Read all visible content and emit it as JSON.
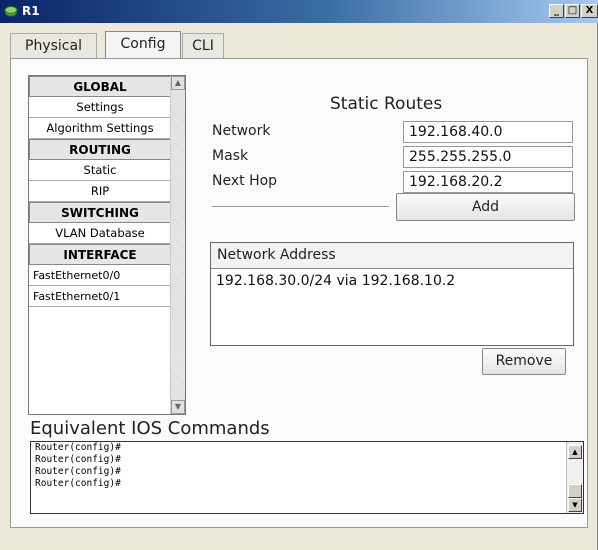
{
  "window": {
    "title": "R1",
    "minimize": "_",
    "maximize": "□",
    "close": "X"
  },
  "tabs": [
    {
      "label": "Physical"
    },
    {
      "label": "Config",
      "selected": true
    },
    {
      "label": "CLI"
    }
  ],
  "sidebar": {
    "items": [
      {
        "label": "GLOBAL",
        "header": true
      },
      {
        "label": "Settings"
      },
      {
        "label": "Algorithm Settings"
      },
      {
        "label": "ROUTING",
        "header": true
      },
      {
        "label": "Static"
      },
      {
        "label": "RIP"
      },
      {
        "label": "SWITCHING",
        "header": true
      },
      {
        "label": "VLAN Database"
      },
      {
        "label": "INTERFACE",
        "header": true
      },
      {
        "label": "FastEthernet0/0"
      },
      {
        "label": "FastEthernet0/1"
      }
    ]
  },
  "static_routes": {
    "heading": "Static Routes",
    "network_label": "Network",
    "network_value": "192.168.40.0",
    "mask_label": "Mask",
    "mask_value": "255.255.255.0",
    "nexthop_label": "Next Hop",
    "nexthop_value": "192.168.20.2",
    "add_label": "Add",
    "table_header": "Network Address",
    "routes": [
      "192.168.30.0/24 via 192.168.10.2"
    ],
    "remove_label": "Remove"
  },
  "ios": {
    "title": "Equivalent IOS Commands",
    "lines": [
      "Router(config)#",
      "Router(config)#",
      "Router(config)#",
      "Router(config)#"
    ]
  }
}
